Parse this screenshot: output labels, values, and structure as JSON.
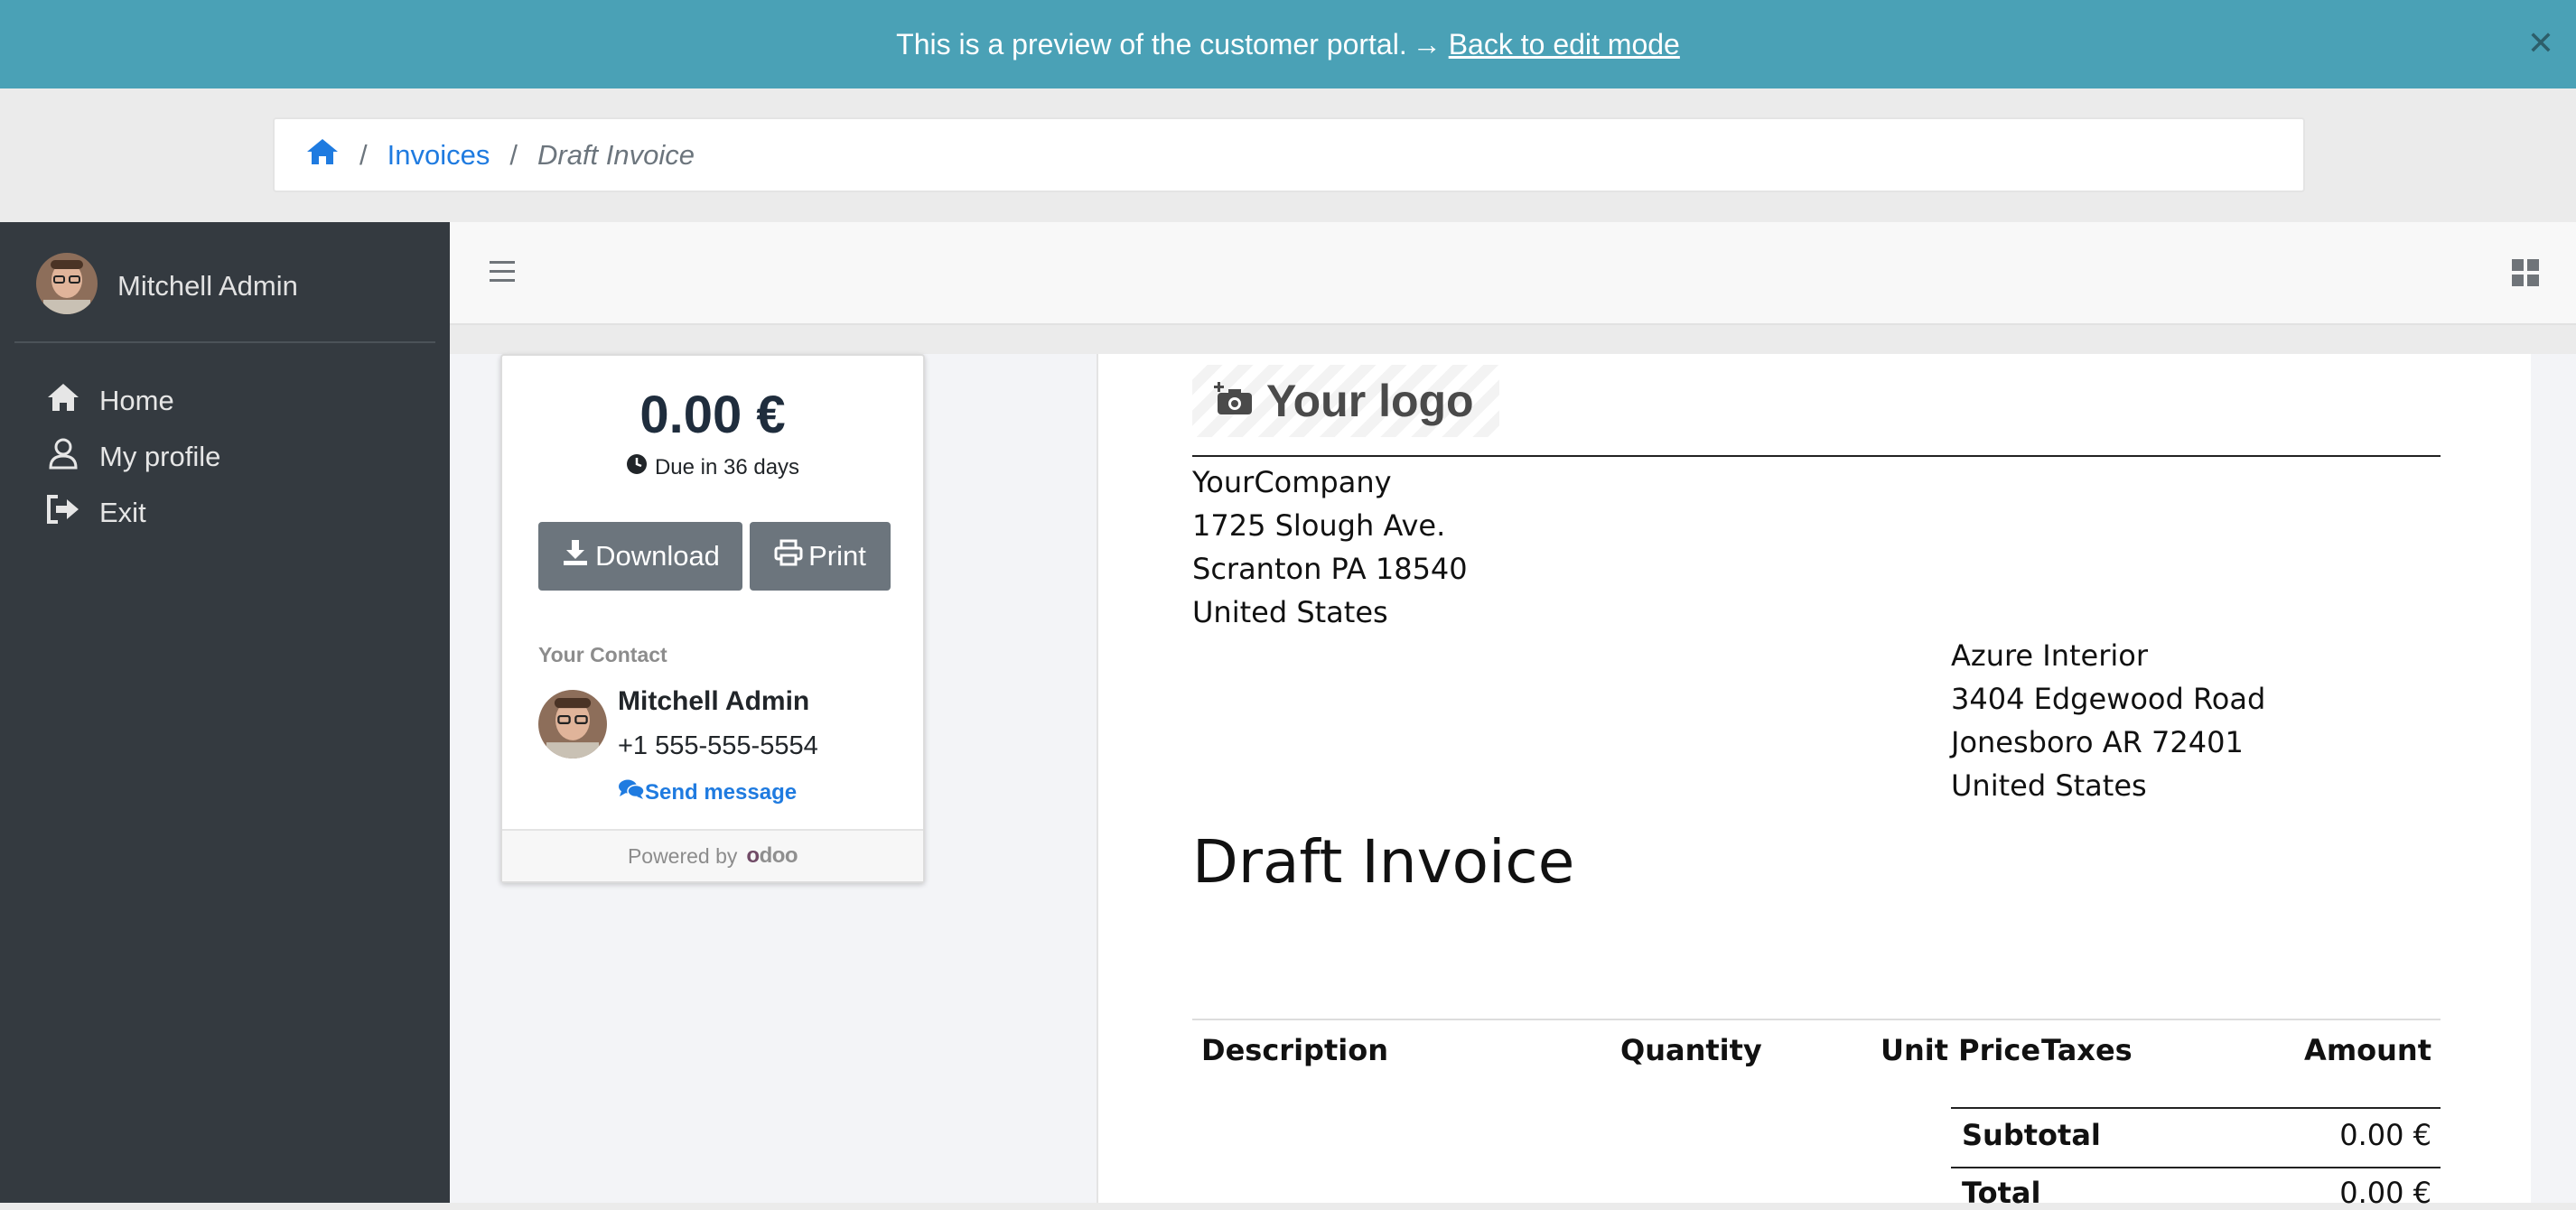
{
  "banner": {
    "text": "This is a preview of the customer portal.",
    "link": "Back to edit mode",
    "color": "#4aa1b6"
  },
  "breadcrumb": {
    "home_icon": "home-icon",
    "items": [
      "Invoices",
      "Draft Invoice"
    ]
  },
  "sidebar": {
    "user_name": "Mitchell Admin",
    "items": [
      {
        "label": "Home",
        "icon": "home-icon"
      },
      {
        "label": "My profile",
        "icon": "user-icon"
      },
      {
        "label": "Exit",
        "icon": "sign-out-icon"
      }
    ]
  },
  "card": {
    "amount": "0.00 €",
    "due": "Due in 36 days",
    "download_label": "Download",
    "print_label": "Print",
    "contact_label": "Your Contact",
    "contact_name": "Mitchell Admin",
    "contact_phone": "+1 555-555-5554",
    "send_message": "Send message",
    "powered_by": "Powered by",
    "brand": "odoo"
  },
  "invoice": {
    "logo_text": "Your logo",
    "company_address": [
      "YourCompany",
      "1725 Slough Ave.",
      "Scranton PA 18540",
      "United States"
    ],
    "customer_address": [
      "Azure Interior",
      "3404 Edgewood Road",
      "Jonesboro AR 72401",
      "United States"
    ],
    "title": "Draft Invoice",
    "columns": [
      "Description",
      "Quantity",
      "Unit Price",
      "Taxes",
      "Amount"
    ],
    "subtotal_label": "Subtotal",
    "subtotal_value": "0.00 €",
    "total_label": "Total",
    "total_value": "0.00 €"
  },
  "colors": {
    "sidebar": "#343a40",
    "link": "#1f7be0",
    "button": "#6c757d"
  }
}
